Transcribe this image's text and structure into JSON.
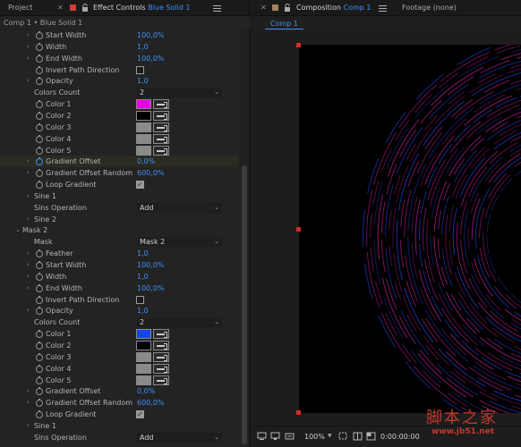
{
  "left_tabs": {
    "project": "Project",
    "effect_controls_prefix": "Effect Controls",
    "effect_controls_layer": "Blue Solid 1"
  },
  "ec_header": "Comp 1 • Blue Solid 1",
  "props": [
    {
      "type": "value",
      "indent": 0,
      "twirl": true,
      "stopwatch": true,
      "label": "Start Width",
      "value": "100,0%"
    },
    {
      "type": "value",
      "indent": 0,
      "twirl": true,
      "stopwatch": true,
      "label": "Width",
      "value": "1,0"
    },
    {
      "type": "value",
      "indent": 0,
      "twirl": true,
      "stopwatch": true,
      "label": "End Width",
      "value": "100,0%"
    },
    {
      "type": "check",
      "indent": 0,
      "twirl": false,
      "stopwatch": true,
      "label": "Invert Path Direction",
      "checked": false
    },
    {
      "type": "value",
      "indent": 0,
      "twirl": true,
      "stopwatch": true,
      "label": "Opacity",
      "value": "1,0"
    },
    {
      "type": "dropdown",
      "indent": -1,
      "twirl": false,
      "stopwatch": false,
      "label": "Colors Count",
      "value": "2"
    },
    {
      "type": "color",
      "indent": 0,
      "twirl": false,
      "stopwatch": true,
      "label": "Color 1",
      "color": "#e600e6"
    },
    {
      "type": "color",
      "indent": 0,
      "twirl": false,
      "stopwatch": true,
      "label": "Color 2",
      "color": "#000000"
    },
    {
      "type": "color",
      "indent": 0,
      "twirl": false,
      "stopwatch": true,
      "label": "Color 3",
      "color": "#8a8a8a"
    },
    {
      "type": "color",
      "indent": 0,
      "twirl": false,
      "stopwatch": true,
      "label": "Color 4",
      "color": "#8a8a8a"
    },
    {
      "type": "color",
      "indent": 0,
      "twirl": false,
      "stopwatch": true,
      "label": "Color 5",
      "color": "#8a8a8a"
    },
    {
      "type": "value",
      "indent": 0,
      "twirl": true,
      "stopwatch": true,
      "stopwatch_on": true,
      "highlight": true,
      "label": "Gradient Offset",
      "value": "0,0%"
    },
    {
      "type": "value",
      "indent": 0,
      "twirl": true,
      "stopwatch": true,
      "label": "Gradient Offset Random",
      "value": "600,0%"
    },
    {
      "type": "check",
      "indent": 0,
      "twirl": false,
      "stopwatch": true,
      "label": "Loop Gradient",
      "checked": true
    },
    {
      "type": "group",
      "indent": -1,
      "twirl": true,
      "stopwatch": false,
      "label": "Sine 1"
    },
    {
      "type": "dropdown",
      "indent": -1,
      "twirl": false,
      "stopwatch": false,
      "label": "Sins Operation",
      "value": "Add"
    },
    {
      "type": "group",
      "indent": -1,
      "twirl": true,
      "stopwatch": false,
      "label": "Sine 2"
    },
    {
      "type": "group",
      "indent": -2,
      "twirl": true,
      "expanded": true,
      "stopwatch": false,
      "label": "Mask 2"
    },
    {
      "type": "dropdown",
      "indent": -1,
      "twirl": false,
      "stopwatch": false,
      "label": "Mask",
      "value": "Mask 2"
    },
    {
      "type": "value",
      "indent": 0,
      "twirl": true,
      "stopwatch": true,
      "label": "Feather",
      "value": "1,0"
    },
    {
      "type": "value",
      "indent": 0,
      "twirl": true,
      "stopwatch": true,
      "label": "Start Width",
      "value": "100,0%"
    },
    {
      "type": "value",
      "indent": 0,
      "twirl": true,
      "stopwatch": true,
      "label": "Width",
      "value": "1,0"
    },
    {
      "type": "value",
      "indent": 0,
      "twirl": true,
      "stopwatch": true,
      "label": "End Width",
      "value": "100,0%"
    },
    {
      "type": "check",
      "indent": 0,
      "twirl": false,
      "stopwatch": true,
      "label": "Invert Path Direction",
      "checked": false
    },
    {
      "type": "value",
      "indent": 0,
      "twirl": true,
      "stopwatch": true,
      "label": "Opacity",
      "value": "1,0"
    },
    {
      "type": "dropdown",
      "indent": -1,
      "twirl": false,
      "stopwatch": false,
      "label": "Colors Count",
      "value": "2"
    },
    {
      "type": "color",
      "indent": 0,
      "twirl": false,
      "stopwatch": true,
      "label": "Color 1",
      "color": "#1346f2"
    },
    {
      "type": "color",
      "indent": 0,
      "twirl": false,
      "stopwatch": true,
      "label": "Color 2",
      "color": "#000000"
    },
    {
      "type": "color",
      "indent": 0,
      "twirl": false,
      "stopwatch": true,
      "label": "Color 3",
      "color": "#8a8a8a"
    },
    {
      "type": "color",
      "indent": 0,
      "twirl": false,
      "stopwatch": true,
      "label": "Color 4",
      "color": "#8a8a8a"
    },
    {
      "type": "color",
      "indent": 0,
      "twirl": false,
      "stopwatch": true,
      "label": "Color 5",
      "color": "#8a8a8a"
    },
    {
      "type": "value",
      "indent": 0,
      "twirl": true,
      "stopwatch": true,
      "label": "Gradient Offset",
      "value": "0,0%"
    },
    {
      "type": "value",
      "indent": 0,
      "twirl": true,
      "stopwatch": true,
      "label": "Gradient Offset Random",
      "value": "600,0%"
    },
    {
      "type": "check",
      "indent": 0,
      "twirl": false,
      "stopwatch": true,
      "label": "Loop Gradient",
      "checked": true
    },
    {
      "type": "group",
      "indent": -1,
      "twirl": true,
      "stopwatch": false,
      "label": "Sine 1"
    },
    {
      "type": "dropdown",
      "indent": -1,
      "twirl": false,
      "stopwatch": false,
      "label": "Sins Operation",
      "value": "Add"
    }
  ],
  "right_tabs": {
    "composition_prefix": "Composition",
    "composition_name": "Comp 1",
    "footage": "Footage (none)"
  },
  "comp_subtab": "Comp 1",
  "viewer_toolbar": {
    "zoom": "100%",
    "timecode": "0:00:00:00"
  },
  "watermark": {
    "text_cn": "脚本之家",
    "url": "www.jb51.net"
  },
  "colors": {
    "accent_blue": "#3f8ff5",
    "ring_magenta": "#b01a8c",
    "ring_blue": "#1e3cc8",
    "handle_red": "#cf2b2b"
  }
}
